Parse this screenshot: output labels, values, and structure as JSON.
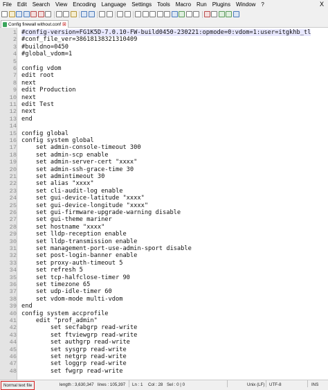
{
  "menu": [
    "File",
    "Edit",
    "Search",
    "View",
    "Encoding",
    "Language",
    "Settings",
    "Tools",
    "Macro",
    "Run",
    "Plugins",
    "Window",
    "?"
  ],
  "window_close": "X",
  "tab": {
    "label": "Config firewall without.conf",
    "close_glyph": "⊠"
  },
  "code_lines": [
    "#config-version=FG1K5D-7.0.10-FW-build0450-230221:opmode=0:vdom=1:user=itgkhb_tl",
    "#conf_file_ver=38618138321310409",
    "#buildno=0450",
    "#global_vdom=1",
    "",
    "config vdom",
    "edit root",
    "next",
    "edit Production",
    "next",
    "edit Test",
    "next",
    "end",
    "",
    "config global",
    "config system global",
    "    set admin-console-timeout 300",
    "    set admin-scp enable",
    "    set admin-server-cert \"xxxx\"",
    "    set admin-ssh-grace-time 30",
    "    set admintimeout 30",
    "    set alias \"xxxx\"",
    "    set cli-audit-log enable",
    "    set gui-device-latitude \"xxxx\"",
    "    set gui-device-longitude \"xxxx\"",
    "    set gui-firmware-upgrade-warning disable",
    "    set gui-theme mariner",
    "    set hostname \"xxxx\"",
    "    set lldp-reception enable",
    "    set lldp-transmission enable",
    "    set management-port-use-admin-sport disable",
    "    set post-login-banner enable",
    "    set proxy-auth-timeout 5",
    "    set refresh 5",
    "    set tcp-halfclose-timer 90",
    "    set timezone 65",
    "    set udp-idle-timer 60",
    "    set vdom-mode multi-vdom",
    "end",
    "config system accprofile",
    "    edit \"prof_admin\"",
    "        set secfabgrp read-write",
    "        set ftviewgrp read-write",
    "        set authgrp read-write",
    "        set sysgrp read-write",
    "        set netgrp read-write",
    "        set loggrp read-write",
    "        set fwgrp read-write"
  ],
  "status": {
    "file_type": "Normal text file",
    "length": "length : 3,630,347",
    "lines": "lines : 105,397",
    "ln": "Ln : 1",
    "col": "Col : 28",
    "sel": "Sel : 0 | 0",
    "eol": "Unix (LF)",
    "encoding": "UTF-8",
    "mode": "INS"
  },
  "colors": {
    "file_type_border": "#d62020",
    "gutter": "#e4e4e4",
    "current_line": "#e8e8ff",
    "tab_close": "#cc3333"
  }
}
